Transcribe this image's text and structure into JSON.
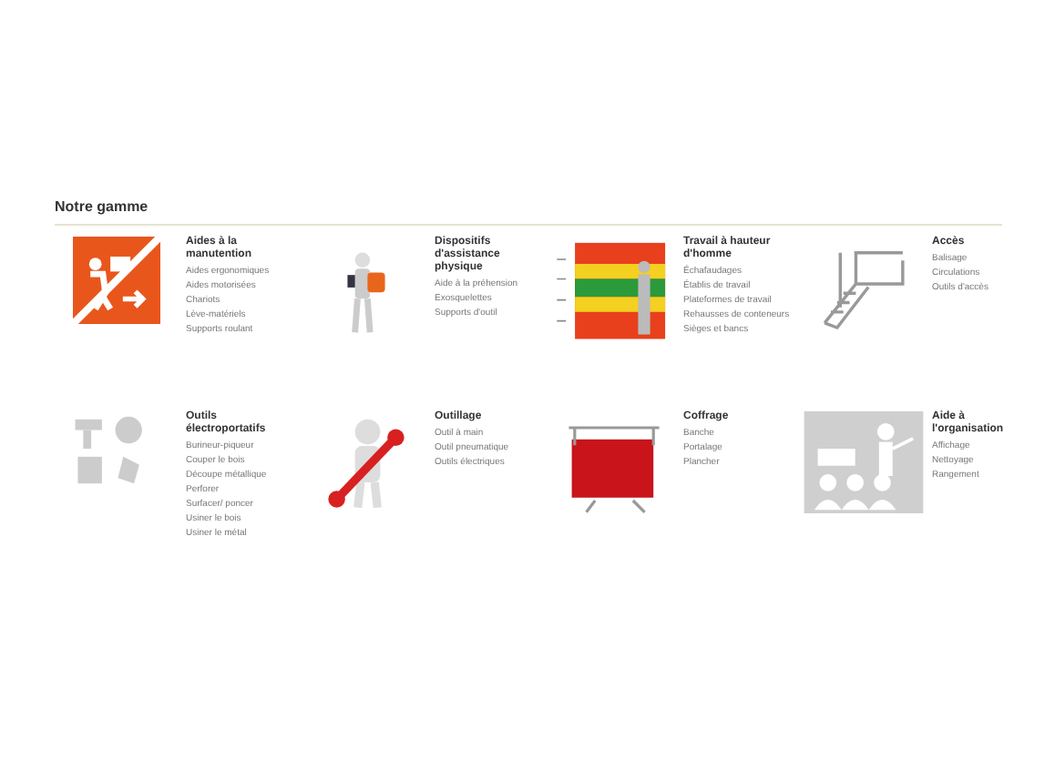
{
  "heading": "Notre gamme",
  "categories": [
    {
      "title": "Aides à la manutention",
      "items": [
        "Aides ergonomiques",
        "Aides motorisées",
        "Chariots",
        "Lève-matériels",
        "Supports roulant"
      ]
    },
    {
      "title": "Dispositifs d'assistance physique",
      "items": [
        "Aide à la préhension",
        "Exosquelettes",
        "Supports d'outil"
      ]
    },
    {
      "title": "Travail à hauteur d'homme",
      "items": [
        "Échafaudages",
        "Établis de travail",
        "Plateformes de travail",
        "Rehausses de conteneurs",
        "Sièges et bancs"
      ]
    },
    {
      "title": "Accès",
      "items": [
        "Balisage",
        "Circulations",
        "Outils d'accès"
      ]
    },
    {
      "title": "Outils électroportatifs",
      "items": [
        "Burineur-piqueur",
        "Couper le bois",
        "Découpe métallique",
        "Perforer",
        "Surfacer/ poncer",
        "Usiner le bois",
        "Usiner le métal"
      ]
    },
    {
      "title": "Outillage",
      "items": [
        "Outil à main",
        "Outil pneumatique",
        "Outils électriques"
      ]
    },
    {
      "title": "Coffrage",
      "items": [
        "Banche",
        "Portalage",
        "Plancher"
      ]
    },
    {
      "title": "Aide à l'organisation",
      "items": [
        "Affichage",
        "Nettoyage",
        "Rangement"
      ]
    }
  ]
}
